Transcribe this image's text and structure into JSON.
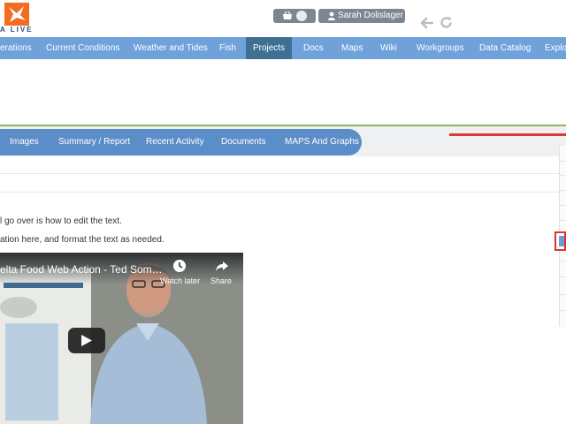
{
  "header": {
    "logo_text": "A LIVE",
    "user_name": "Sarah Dolislager"
  },
  "main_nav": [
    {
      "label": "erations"
    },
    {
      "label": "Current Conditions"
    },
    {
      "label": "Weather and Tides"
    },
    {
      "label": "Fish"
    },
    {
      "label": "Projects",
      "active": true
    },
    {
      "label": "Docs"
    },
    {
      "label": "Maps"
    },
    {
      "label": "Wiki"
    },
    {
      "label": "Workgroups"
    },
    {
      "label": "Data Catalog"
    },
    {
      "label": "Explor"
    }
  ],
  "sub_nav": [
    {
      "label": "Images"
    },
    {
      "label": "Summary / Report"
    },
    {
      "label": "Recent Activity"
    },
    {
      "label": "Documents"
    },
    {
      "label": "MAPS And Graphs"
    }
  ],
  "content": {
    "line1": "l go over is how to edit the text.",
    "line2": "ation here, and format the text as needed."
  },
  "video": {
    "title": "elta Food Web Action - Ted Som…",
    "watch_later": "Watch later",
    "share": "Share"
  },
  "colors": {
    "nav_bg": "#6fa2db",
    "nav_active": "#3f7094",
    "sub_nav_bg": "#5b8dc9",
    "logo": "#f26c22",
    "accent_red": "#e03a2e",
    "divider_green": "#8cb465"
  }
}
